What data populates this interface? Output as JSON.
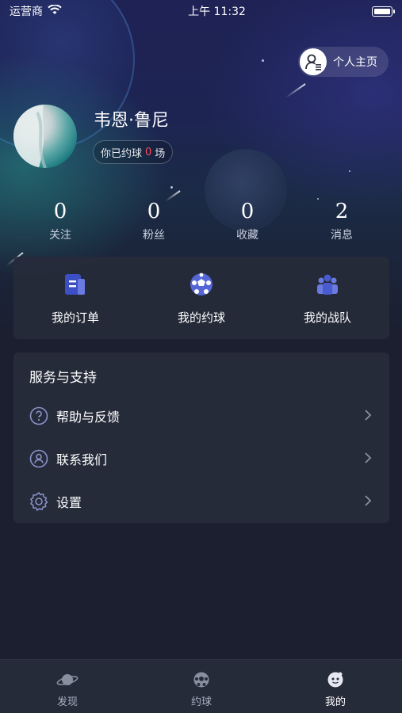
{
  "status_bar": {
    "carrier": "运营商",
    "time": "上午 11:32"
  },
  "header": {
    "profile_button_label": "个人主页"
  },
  "user": {
    "name": "韦恩·鲁尼",
    "match_prefix": "你已约球",
    "match_count": "0",
    "match_suffix": "场"
  },
  "stats": [
    {
      "value": "0",
      "label": "关注"
    },
    {
      "value": "0",
      "label": "粉丝"
    },
    {
      "value": "0",
      "label": "收藏"
    },
    {
      "value": "2",
      "label": "消息"
    }
  ],
  "quick_actions": [
    {
      "label": "我的订单",
      "icon": "order-icon"
    },
    {
      "label": "我的约球",
      "icon": "football-icon"
    },
    {
      "label": "我的战队",
      "icon": "team-icon"
    }
  ],
  "service": {
    "title": "服务与支持",
    "items": [
      {
        "label": "帮助与反馈",
        "icon": "help-icon"
      },
      {
        "label": "联系我们",
        "icon": "contact-icon"
      },
      {
        "label": "设置",
        "icon": "settings-icon"
      }
    ]
  },
  "tabs": [
    {
      "label": "发现",
      "icon": "planet-icon",
      "active": false
    },
    {
      "label": "约球",
      "icon": "football-icon",
      "active": false
    },
    {
      "label": "我的",
      "icon": "profile-face-icon",
      "active": true
    }
  ],
  "colors": {
    "accent": "#4a5bd0",
    "count_highlight": "#ff4a5e",
    "card_bg": "#262b3a",
    "page_bg": "#1b1f30"
  }
}
